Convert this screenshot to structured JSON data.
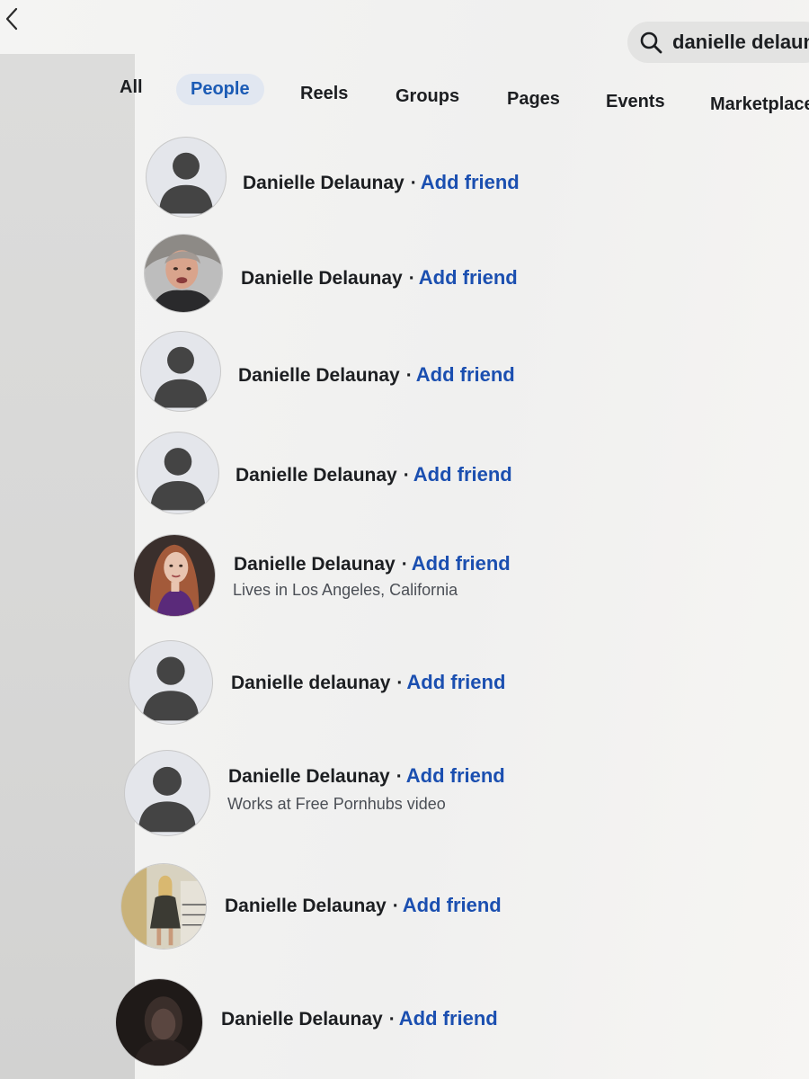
{
  "search": {
    "value": "danielle delaunay"
  },
  "tabs": [
    {
      "label": "All"
    },
    {
      "label": "People"
    },
    {
      "label": "Reels"
    },
    {
      "label": "Groups"
    },
    {
      "label": "Pages"
    },
    {
      "label": "Events"
    },
    {
      "label": "Marketplace"
    }
  ],
  "active_tab": "People",
  "results": [
    {
      "name": "Danielle Delaunay",
      "action": "Add friend",
      "avatar": "default-avatar-icon"
    },
    {
      "name": "Danielle Delaunay",
      "action": "Add friend",
      "avatar": "profile-photo"
    },
    {
      "name": "Danielle Delaunay",
      "action": "Add friend",
      "avatar": "default-avatar-icon"
    },
    {
      "name": "Danielle Delaunay",
      "action": "Add friend",
      "avatar": "default-avatar-icon"
    },
    {
      "name": "Danielle Delaunay",
      "action": "Add friend",
      "detail": "Lives in Los Angeles, California",
      "avatar": "profile-photo"
    },
    {
      "name": "Danielle delaunay",
      "action": "Add friend",
      "avatar": "default-avatar-icon"
    },
    {
      "name": "Danielle Delaunay",
      "action": "Add friend",
      "detail": "Works at Free Pornhubs video",
      "avatar": "default-avatar-icon"
    },
    {
      "name": "Danielle Delaunay",
      "action": "Add friend",
      "avatar": "profile-photo"
    },
    {
      "name": "Danielle Delaunay",
      "action": "Add friend",
      "avatar": "profile-photo"
    }
  ],
  "separator": "·",
  "colors": {
    "accent_blue": "#1b4fb0",
    "active_tab_bg": "#e1e7f1",
    "text_primary": "#1c1e21",
    "text_secondary": "#4b4f56",
    "default_avatar_bg": "#e4e6eb",
    "default_avatar_silhouette": "#444444"
  }
}
